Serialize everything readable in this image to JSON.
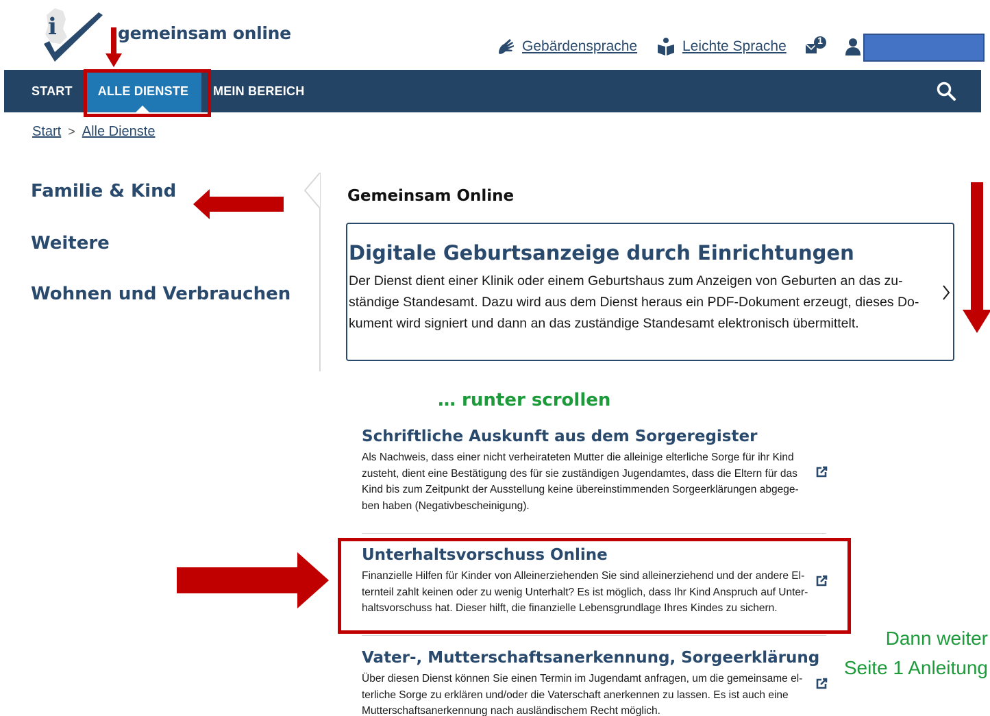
{
  "header": {
    "brand": "gemeinsam online",
    "sign_language_label": "Gebärdensprache",
    "easy_language_label": "Leichte Sprache",
    "mail_badge_count": "1",
    "user_box_color": "#4472c4"
  },
  "nav": {
    "items": [
      {
        "label": "START"
      },
      {
        "label": "ALLE DIENSTE",
        "active": true
      },
      {
        "label": "MEIN BEREICH"
      }
    ],
    "search_icon": "search-icon",
    "bar_color": "#244466",
    "active_color": "#1f77b4"
  },
  "breadcrumb": {
    "items": [
      "Start",
      "Alle Dienste"
    ],
    "separator": ">"
  },
  "categories": [
    "Familie & Kind",
    "Weitere",
    "Wohnen und Verbrauchen"
  ],
  "main": {
    "section_title": "Gemeinsam Online",
    "featured": {
      "title": "Digitale Geburtsanzeige durch Einrichtungen",
      "lines": [
        "Der Dienst dient einer Klinik oder einem Geburtshaus zum Anzeigen von Geburten an das zu-",
        "ständige Standesamt. Dazu wird aus dem Dienst heraus ein PDF-Dokument erzeugt, dieses Do-",
        "kument wird signiert und dann an das zuständige Standesamt elektronisch übermittelt."
      ]
    },
    "services": [
      {
        "title": "Schriftliche Auskunft aus dem Sorgeregister",
        "lines": [
          "Als Nachweis, dass einer nicht verheirateten Mutter die alleinige elterliche Sorge für ihr Kind",
          "zusteht, dient eine Bestätigung des für sie zuständigen Jugendamtes, dass die Eltern für das",
          "Kind bis zum Zeitpunkt der Ausstellung keine übereinstimmenden Sorgeerklärungen abgege-",
          "ben haben (Negativbescheinigung)."
        ]
      },
      {
        "title": "Unterhaltsvorschuss Online",
        "lines": [
          "Finanzielle Hilfen für Kinder von Alleinerziehenden Sie sind alleinerziehend und der andere El-",
          "ternteil zahlt keinen oder zu wenig Unterhalt? Es ist möglich, dass Ihr Kind Anspruch auf Unter-",
          "haltsvorschuss hat. Dieser hilft, die finanzielle Lebensgrundlage Ihres Kindes zu sichern."
        ]
      },
      {
        "title": "Vater-, Mutterschaftsanerkennung, Sorgeerklärung",
        "lines": [
          "Über diesen Dienst können Sie einen Termin im Jugendamt anfragen, um die gemeinsame el-",
          "terliche Sorge zu erklären und/oder die Vaterschaft anerkennen zu lassen. Es ist auch eine",
          "Mutterschaftsanerkennung nach ausländischem Recht möglich."
        ]
      }
    ]
  },
  "annotations": {
    "scroll_hint": "… runter scrollen",
    "next_step_lines": [
      "Dann weiter",
      "Seite 1 Anleitung"
    ],
    "arrow_color": "#c00000",
    "hint_color": "#1d9b3b"
  }
}
